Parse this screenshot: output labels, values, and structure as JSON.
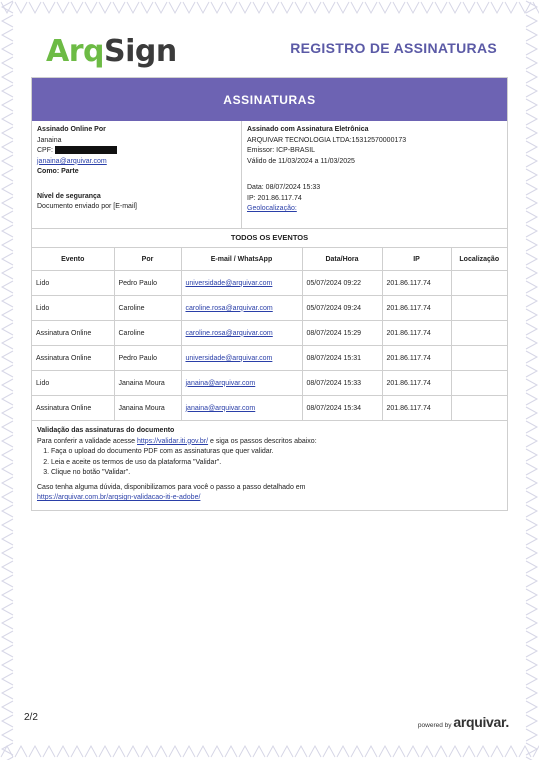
{
  "header": {
    "logo_part1": "Arq",
    "logo_part2": "Sign",
    "doc_title": "REGISTRO DE ASSINATURAS"
  },
  "section_title": "ASSINATURAS",
  "signer": {
    "label": "Assinado Online Por",
    "name": "Janaina",
    "cpf_label": "CPF:",
    "email": "janaina@arquivar.com",
    "role": "Como: Parte",
    "security_level": "Nível de segurança",
    "sent_by": "Documento enviado por [E-mail]"
  },
  "certificate": {
    "label": "Assinado com Assinatura Eletrônica",
    "company": "ARQUIVAR TECNOLOGIA LTDA:15312570000173",
    "issuer": "Emissor: ICP-BRASIL",
    "validity": "Válido de 11/03/2024 a 11/03/2025",
    "date": "Data: 08/07/2024 15:33",
    "ip": "IP: 201.86.117.74",
    "geo": "Geolocalização:"
  },
  "events": {
    "title": "TODOS OS EVENTOS",
    "headers": [
      "Evento",
      "Por",
      "E-mail / WhatsApp",
      "Data/Hora",
      "IP",
      "Localização"
    ],
    "rows": [
      {
        "evento": "Lido",
        "por": "Pedro Paulo",
        "email": "universidade@arquivar.com",
        "data": "05/07/2024 09:22",
        "ip": "201.86.117.74",
        "loc": ""
      },
      {
        "evento": "Lido",
        "por": "Caroline",
        "email": "caroline.rosa@arquivar.com",
        "data": "05/07/2024 09:24",
        "ip": "201.86.117.74",
        "loc": ""
      },
      {
        "evento": "Assinatura Online",
        "por": "Caroline",
        "email": "caroline.rosa@arquivar.com",
        "data": "08/07/2024 15:29",
        "ip": "201.86.117.74",
        "loc": ""
      },
      {
        "evento": "Assinatura Online",
        "por": "Pedro Paulo",
        "email": "universidade@arquivar.com",
        "data": "08/07/2024 15:31",
        "ip": "201.86.117.74",
        "loc": ""
      },
      {
        "evento": "Lido",
        "por": "Janaina Moura",
        "email": "janaina@arquivar.com",
        "data": "08/07/2024 15:33",
        "ip": "201.86.117.74",
        "loc": ""
      },
      {
        "evento": "Assinatura Online",
        "por": "Janaina Moura",
        "email": "janaina@arquivar.com",
        "data": "08/07/2024 15:34",
        "ip": "201.86.117.74",
        "loc": ""
      }
    ]
  },
  "validation": {
    "title": "Validação das assinaturas do documento",
    "intro_before": "Para conferir a validade acesse ",
    "intro_link": "https://validar.iti.gov.br/",
    "intro_after": " e siga os passos descritos abaixo:",
    "steps": [
      "Faça o upload do documento PDF com as assinaturas que quer validar.",
      "Leia e aceite os termos de uso da plataforma \"Validar\".",
      "Clique no botão \"Validar\"."
    ],
    "help": "Caso tenha alguma dúvida, disponibilizamos para você o passo a passo detalhado em",
    "help_link": "https://arquivar.com.br/arqsign-validacao-iti-e-adobe/"
  },
  "footer": {
    "page": "2/2",
    "powered_by": "powered by",
    "brand": "arquivar."
  },
  "colors": {
    "header_bar": "#6d63b3",
    "title": "#5b5aa6",
    "logo_green": "#6dbb45",
    "link": "#2a3fa8"
  }
}
